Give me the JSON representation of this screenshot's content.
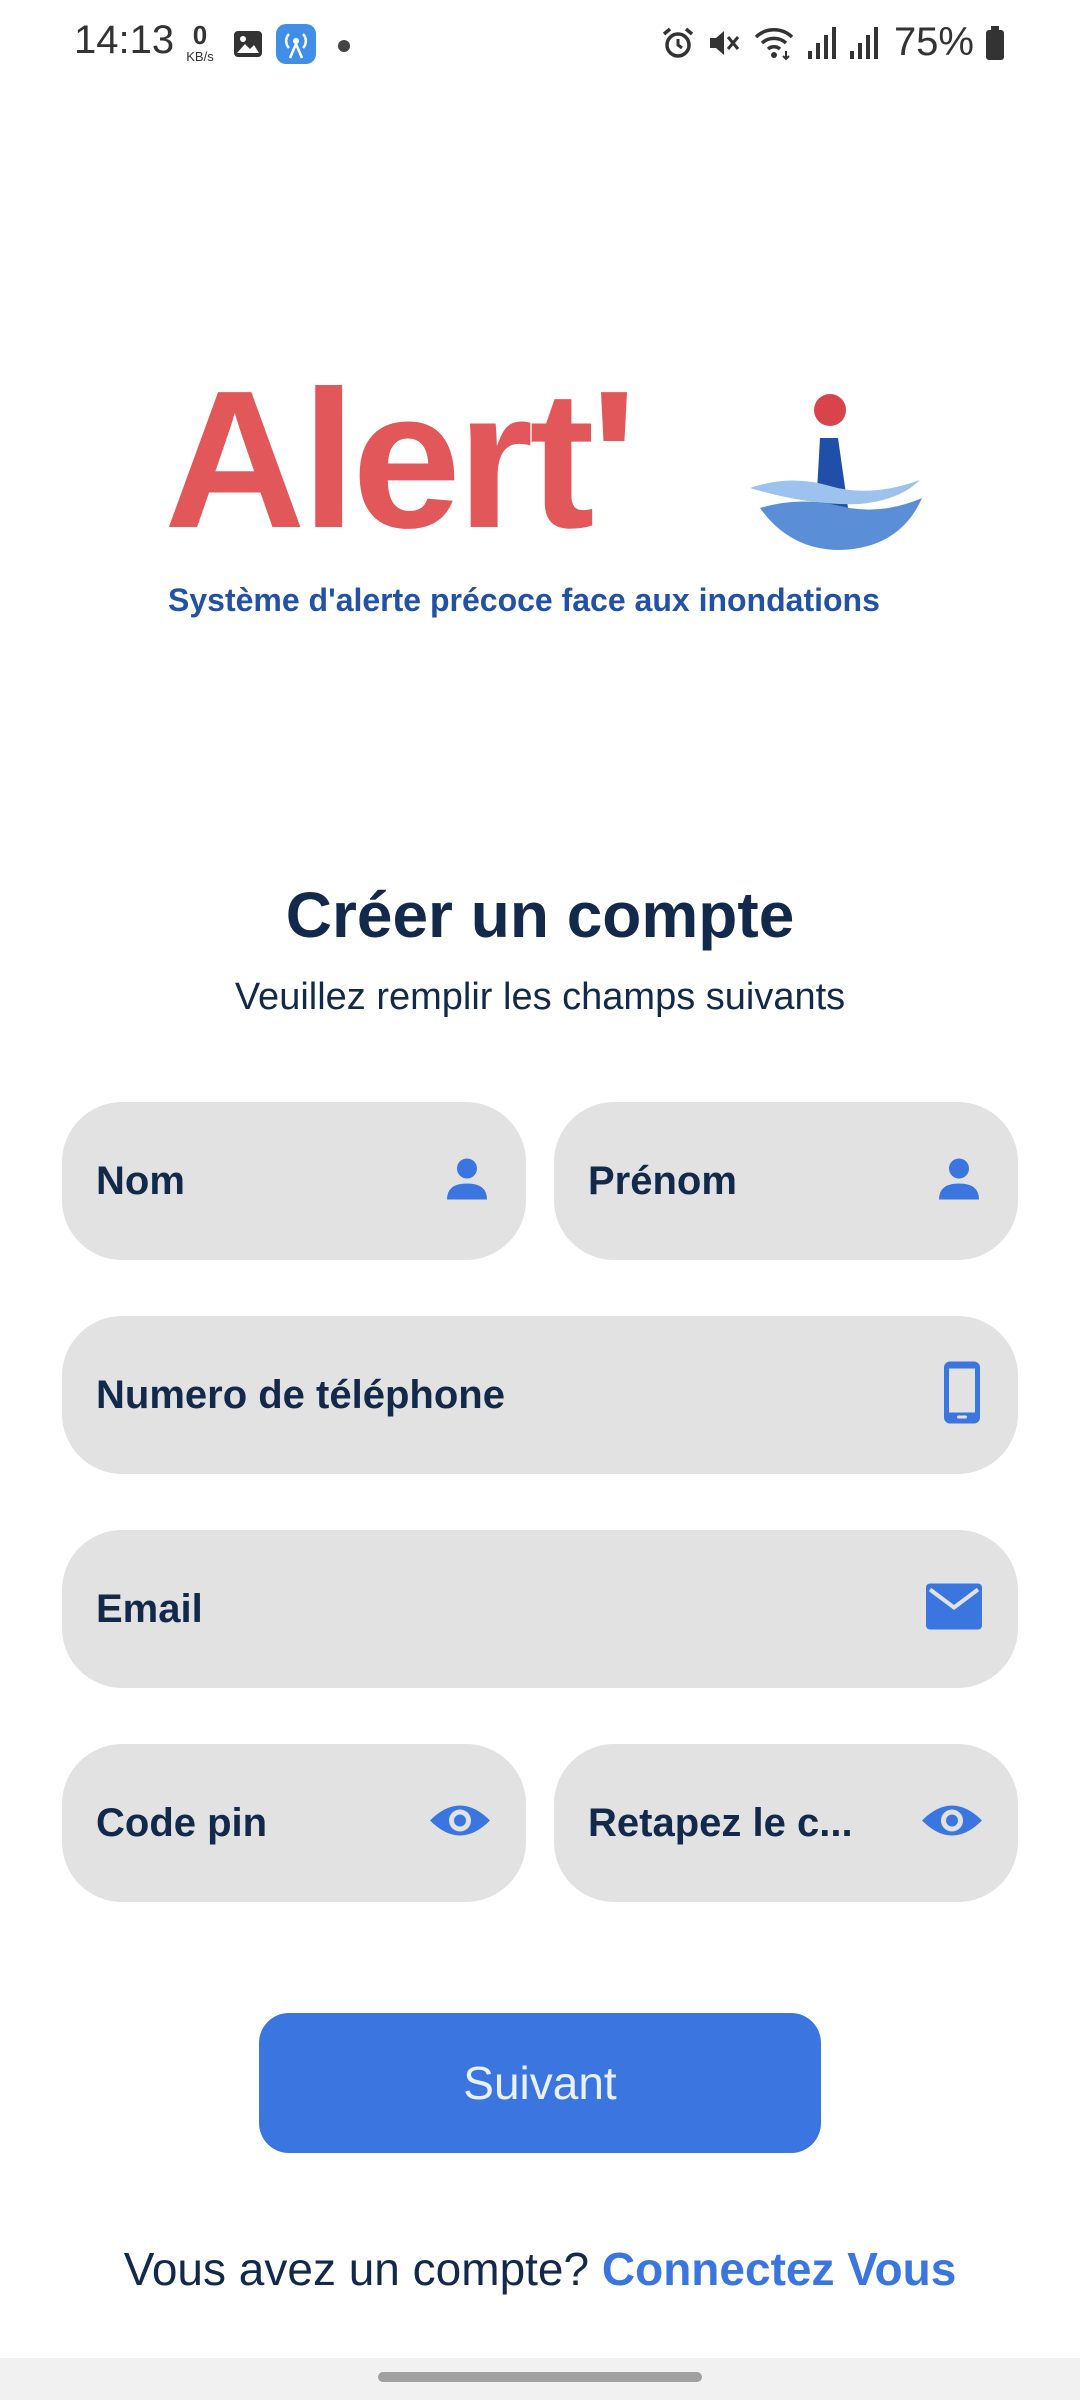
{
  "status_bar": {
    "time": "14:13",
    "net_speed_value": "0",
    "net_speed_unit": "KB/s",
    "battery": "75%",
    "icons": [
      "gallery-icon",
      "radio-app-icon",
      "notification-dot-icon",
      "alarm-icon",
      "mute-icon",
      "wifi-icon",
      "signal-icon",
      "signal-icon",
      "battery-icon"
    ]
  },
  "logo": {
    "word": "Alert'",
    "tagline": "Système d'alerte précoce face aux inondations"
  },
  "header": {
    "title": "Créer un compte",
    "subtitle": "Veuillez remplir les champs suivants"
  },
  "form": {
    "nom": "Nom",
    "prenom": "Prénom",
    "phone": "Numero de téléphone",
    "email": "Email",
    "pin": "Code pin",
    "repin": "Retapez le c..."
  },
  "actions": {
    "next": "Suivant",
    "has_account": "Vous avez un compte?",
    "login_link": "Connectez Vous"
  },
  "colors": {
    "brand_red": "#e2585a",
    "brand_blue": "#2351a6",
    "accent": "#3b76e0",
    "text_dark": "#13294b",
    "field_bg": "#e2e2e2"
  }
}
